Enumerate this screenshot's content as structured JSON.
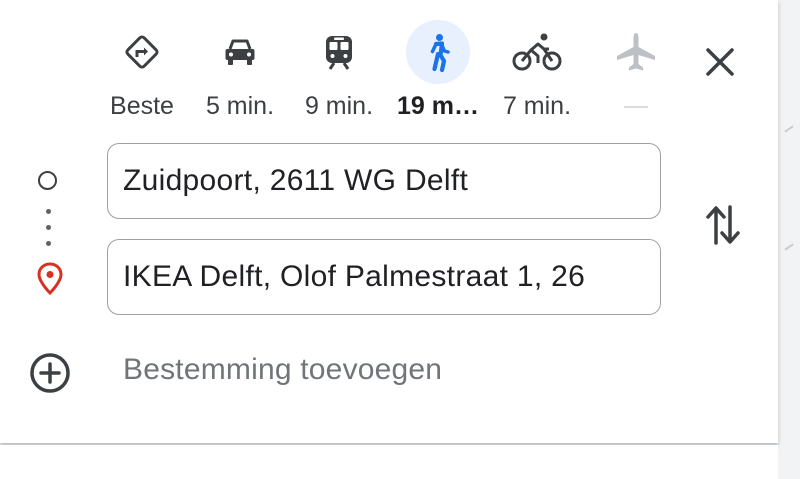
{
  "travel_modes": [
    {
      "id": "best",
      "label": "Beste",
      "icon": "directions-diamond-icon",
      "selected": false,
      "disabled": false
    },
    {
      "id": "car",
      "label": "5 min.",
      "icon": "car-icon",
      "selected": false,
      "disabled": false
    },
    {
      "id": "transit",
      "label": "9 min.",
      "icon": "train-icon",
      "selected": false,
      "disabled": false
    },
    {
      "id": "walk",
      "label": "19 m…",
      "icon": "walking-icon",
      "selected": true,
      "disabled": false
    },
    {
      "id": "bike",
      "label": "7 min.",
      "icon": "bicycle-icon",
      "selected": false,
      "disabled": false
    },
    {
      "id": "flight",
      "label": "",
      "icon": "airplane-icon",
      "selected": false,
      "disabled": true
    }
  ],
  "route": {
    "origin": "Zuidpoort, 2611 WG Delft",
    "destination": "IKEA Delft, Olof Palmestraat 1, 26"
  },
  "add_destination_label": "Bestemming toevoegen",
  "colors": {
    "selected_bg": "#e8f0fe",
    "selected_icon": "#1a73e8",
    "pin": "#d93025",
    "icon": "#3c4043",
    "disabled_icon": "#bdc1c6"
  }
}
